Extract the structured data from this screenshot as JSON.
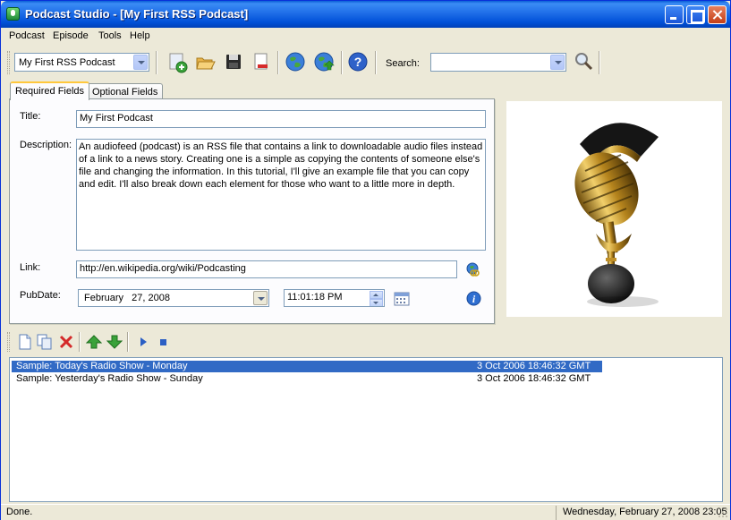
{
  "window": {
    "title": "Podcast Studio - [My First RSS Podcast]"
  },
  "menu": [
    "Podcast",
    "Episode",
    "Tools",
    "Help"
  ],
  "toolbar": {
    "podcast_select": "My First RSS Podcast",
    "search_label": "Search:",
    "search_value": "",
    "icons": [
      "new-podcast-icon",
      "open-folder-icon",
      "save-disk-icon",
      "delete-document-icon",
      "publish-globe-icon",
      "upload-globe-icon",
      "help-icon",
      "search-magnifier-icon"
    ]
  },
  "tabs": [
    {
      "label": "Required Fields",
      "active": true
    },
    {
      "label": "Optional Fields",
      "active": false
    }
  ],
  "form": {
    "title_label": "Title:",
    "title_value": "My First Podcast",
    "description_label": "Description:",
    "description_value": "An audiofeed (podcast) is an RSS file that contains a link to downloadable audio files instead of a link to a news story. Creating one is a simple as copying the contents of someone else's file and changing the information. In this tutorial, I'll give an example file that you can copy and edit. I'll also break down each element for those who want to a little more in depth.",
    "link_label": "Link:",
    "link_value": "http://en.wikipedia.org/wiki/Podcasting",
    "pubdate_label": "PubDate:",
    "pubdate_date": "February   27, 2008",
    "pubdate_time": "11:01:18 PM"
  },
  "image": {
    "icon": "microphone-image"
  },
  "episode_toolbar": {
    "icons": [
      "new-episode-icon",
      "copy-episode-icon",
      "delete-episode-icon",
      "move-up-icon",
      "move-down-icon",
      "play-icon",
      "stop-icon"
    ]
  },
  "episodes": [
    {
      "name": "Sample: Today's Radio Show - Monday",
      "date": "3 Oct 2006 18:46:32 GMT",
      "selected": true
    },
    {
      "name": "Sample: Yesterday's Radio Show - Sunday",
      "date": "3 Oct 2006 18:46:32 GMT",
      "selected": false
    }
  ],
  "status": {
    "left": "Done.",
    "right": "Wednesday, February 27, 2008 23:05"
  },
  "colors": {
    "titlebar": "#0a5fd6",
    "selection": "#316ac5",
    "window_bg": "#ece9d8"
  }
}
